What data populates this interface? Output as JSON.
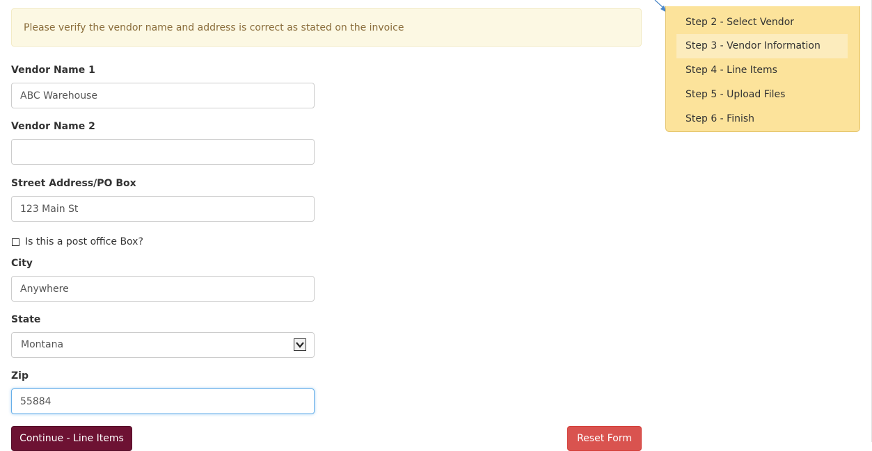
{
  "alert": {
    "text": "Please verify the vendor name and address is correct as stated on the invoice"
  },
  "form": {
    "vendor_name_1": {
      "label": "Vendor Name 1",
      "value": "ABC Warehouse"
    },
    "vendor_name_2": {
      "label": "Vendor Name 2",
      "value": ""
    },
    "street": {
      "label": "Street Address/PO Box",
      "value": "123 Main St"
    },
    "po_box_checkbox": {
      "label": "Is this a post office Box?",
      "checked": false
    },
    "city": {
      "label": "City",
      "value": "Anywhere"
    },
    "state": {
      "label": "State",
      "value": "Montana"
    },
    "zip": {
      "label": "Zip",
      "value": "55884"
    }
  },
  "buttons": {
    "continue": "Continue - Line Items",
    "reset": "Reset Form"
  },
  "steps": {
    "items": [
      {
        "label": "Step 2 - Select Vendor",
        "active": false
      },
      {
        "label": "Step 3 - Vendor Information",
        "active": true
      },
      {
        "label": "Step 4 - Line Items",
        "active": false
      },
      {
        "label": "Step 5 - Upload Files",
        "active": false
      },
      {
        "label": "Step 6 - Finish",
        "active": false
      }
    ]
  },
  "colors": {
    "accent": "#6d1233",
    "danger": "#d9534f",
    "alert_bg": "#fcf8e3",
    "steps_bg": "#fce39b",
    "focus": "#66afe9"
  }
}
